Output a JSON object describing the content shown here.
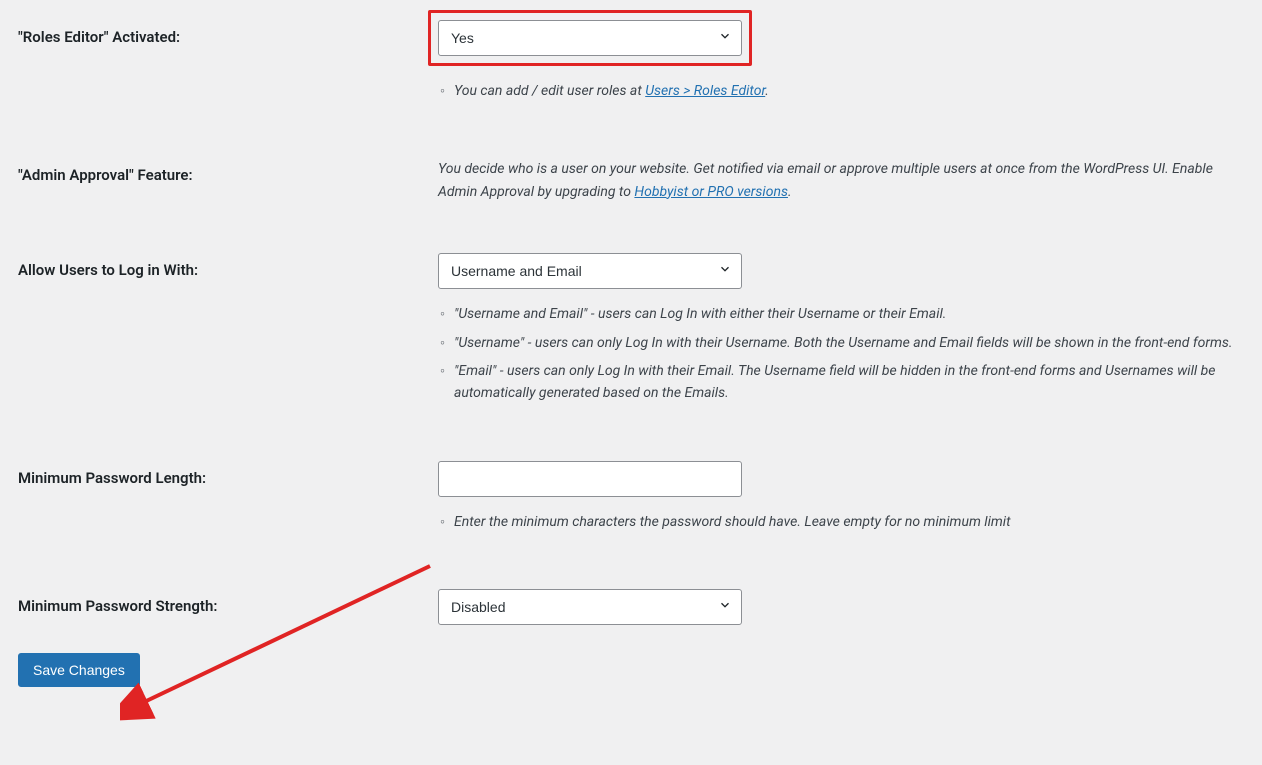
{
  "rolesEditor": {
    "label": "\"Roles Editor\" Activated:",
    "selected": "Yes",
    "hintPrefix": "You can add / edit user roles at ",
    "hintLink": "Users > Roles Editor",
    "hintSuffix": "."
  },
  "adminApproval": {
    "label": "\"Admin Approval\" Feature:",
    "textPrefix": "You decide who is a user on your website. Get notified via email or approve multiple users at once from the WordPress UI. Enable Admin Approval by upgrading to ",
    "textLink": "Hobbyist or PRO versions",
    "textSuffix": "."
  },
  "loginWith": {
    "label": "Allow Users to Log in With:",
    "selected": "Username and Email",
    "hints": [
      "\"Username and Email\" - users can Log In with either their Username or their Email.",
      "\"Username\" - users can only Log In with their Username. Both the Username and Email fields will be shown in the front-end forms.",
      "\"Email\" - users can only Log In with their Email. The Username field will be hidden in the front-end forms and Usernames will be automatically generated based on the Emails."
    ]
  },
  "minPwdLength": {
    "label": "Minimum Password Length:",
    "value": "",
    "hint": "Enter the minimum characters the password should have. Leave empty for no minimum limit"
  },
  "minPwdStrength": {
    "label": "Minimum Password Strength:",
    "selected": "Disabled"
  },
  "saveButton": "Save Changes"
}
